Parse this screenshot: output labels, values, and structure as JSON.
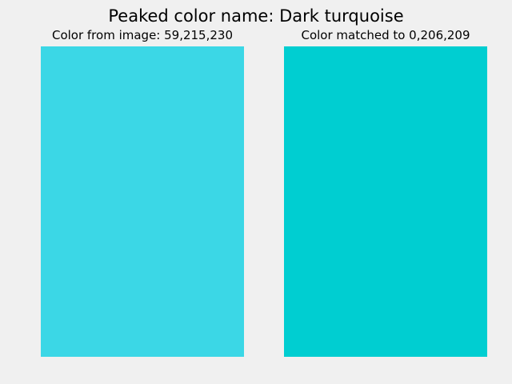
{
  "title": "Peaked color name: Dark turquoise",
  "panels": [
    {
      "label": "Color from image: 59,215,230",
      "color": "#3bd7e6"
    },
    {
      "label": "Color matched to 0,206,209",
      "color": "#00ced1"
    }
  ]
}
